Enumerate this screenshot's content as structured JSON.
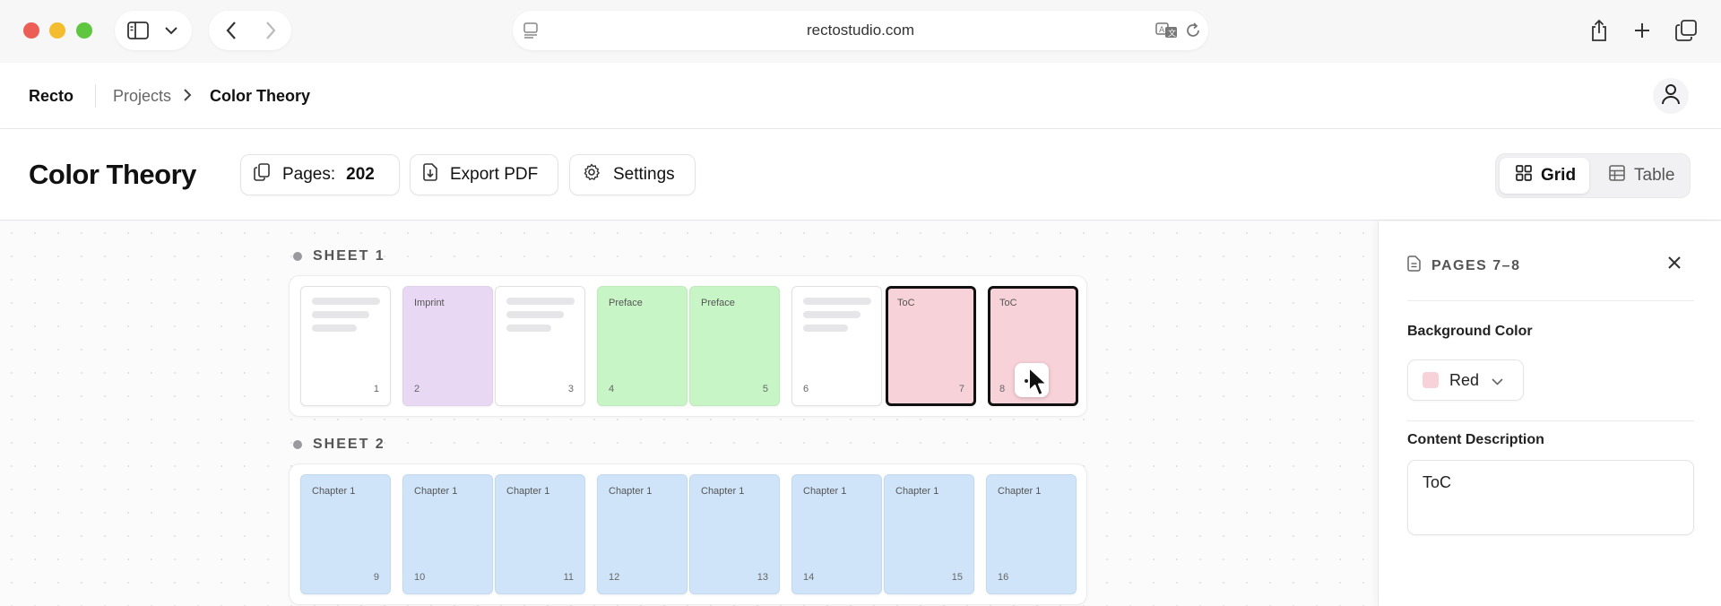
{
  "browser": {
    "url": "rectostudio.com"
  },
  "app": {
    "brand": "Recto",
    "breadcrumb": {
      "projects": "Projects",
      "current": "Color Theory"
    }
  },
  "toolbar": {
    "title": "Color Theory",
    "pages_label": "Pages:",
    "pages_count": "202",
    "export_label": "Export PDF",
    "settings_label": "Settings",
    "view_grid_label": "Grid",
    "view_table_label": "Table",
    "active_view": "Grid"
  },
  "sheets": [
    {
      "label": "SHEET 1",
      "pages": [
        {
          "number": "1",
          "label": "",
          "color": "white"
        },
        {
          "number": "2",
          "label": "Imprint",
          "color": "purple"
        },
        {
          "number": "3",
          "label": "",
          "color": "white"
        },
        {
          "number": "4",
          "label": "Preface",
          "color": "green"
        },
        {
          "number": "5",
          "label": "Preface",
          "color": "green"
        },
        {
          "number": "6",
          "label": "",
          "color": "white"
        },
        {
          "number": "7",
          "label": "ToC",
          "color": "red",
          "selected": true
        },
        {
          "number": "8",
          "label": "ToC",
          "color": "red",
          "selected": true
        }
      ]
    },
    {
      "label": "SHEET 2",
      "pages": [
        {
          "number": "9",
          "label": "Chapter 1",
          "color": "blue"
        },
        {
          "number": "10",
          "label": "Chapter 1",
          "color": "blue"
        },
        {
          "number": "11",
          "label": "Chapter 1",
          "color": "blue"
        },
        {
          "number": "12",
          "label": "Chapter 1",
          "color": "blue"
        },
        {
          "number": "13",
          "label": "Chapter 1",
          "color": "blue"
        },
        {
          "number": "14",
          "label": "Chapter 1",
          "color": "blue"
        },
        {
          "number": "15",
          "label": "Chapter 1",
          "color": "blue"
        },
        {
          "number": "16",
          "label": "Chapter 1",
          "color": "blue"
        }
      ]
    }
  ],
  "panel": {
    "title": "PAGES 7–8",
    "bg_color_label": "Background Color",
    "bg_color_value": "Red",
    "content_desc_label": "Content Description",
    "content_desc_value": "ToC"
  },
  "colors": {
    "white": "#ffffff",
    "purple": "#e8d8f4",
    "green": "#c8f5c6",
    "red": "#f7d2d8",
    "blue": "#cfe4f8"
  }
}
